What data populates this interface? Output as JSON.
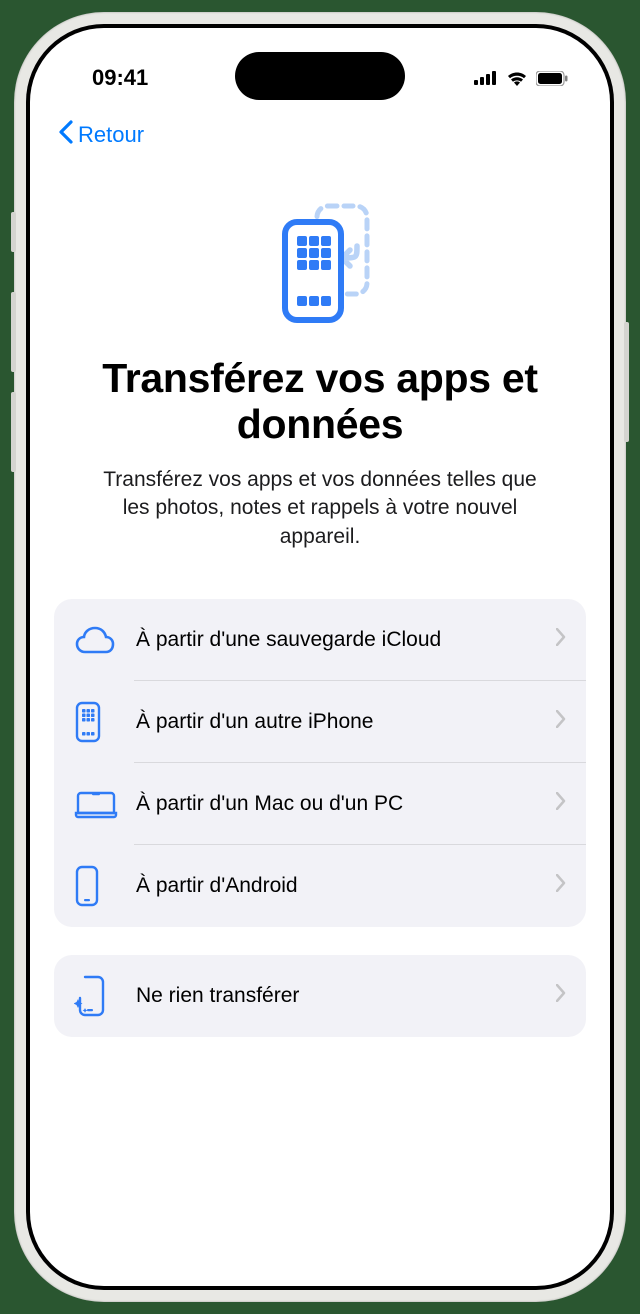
{
  "status_bar": {
    "time": "09:41"
  },
  "nav": {
    "back_label": "Retour"
  },
  "hero": {
    "title": "Transférez vos apps et données",
    "subtitle": "Transférez vos apps et vos données telles que les photos, notes et rappels à votre nouvel appareil."
  },
  "options": {
    "icloud": "À partir d'une sauvegarde iCloud",
    "iphone": "À partir d'un autre iPhone",
    "mac_pc": "À partir d'un Mac ou d'un PC",
    "android": "À partir d'Android",
    "none": "Ne rien transférer"
  },
  "colors": {
    "accent": "#007aff",
    "group_bg": "#f2f2f7",
    "chevron": "#c4c4c6"
  }
}
